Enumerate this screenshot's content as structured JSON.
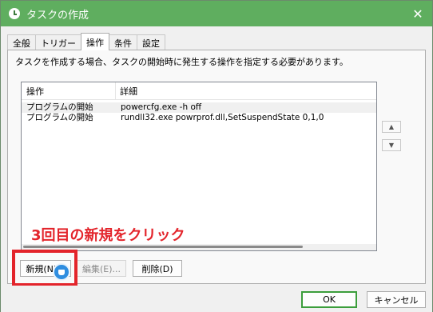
{
  "window": {
    "title": "タスクの作成",
    "close_symbol": "✕"
  },
  "tabs": [
    {
      "label": "全般",
      "active": false
    },
    {
      "label": "トリガー",
      "active": false
    },
    {
      "label": "操作",
      "active": true
    },
    {
      "label": "条件",
      "active": false
    },
    {
      "label": "設定",
      "active": false
    }
  ],
  "instruction": "タスクを作成する場合、タスクの開始時に発生する操作を指定する必要があります。",
  "list": {
    "columns": [
      "操作",
      "詳細"
    ],
    "rows": [
      {
        "action": "プログラムの開始",
        "detail": "powercfg.exe -h off"
      },
      {
        "action": "プログラムの開始",
        "detail": "rundll32.exe powrprof.dll,SetSuspendState 0,1,0"
      }
    ]
  },
  "move_buttons": {
    "up_symbol": "▲",
    "down_symbol": "▼"
  },
  "buttons": {
    "new": "新規(N)...",
    "edit": "編集(E)...",
    "delete": "削除(D)",
    "ok": "OK",
    "cancel": "キャンセル"
  },
  "annotation": {
    "text": "3回目の新規をクリック",
    "color": "#e3242b"
  },
  "colors": {
    "titlebar": "#5fae5f",
    "accent_border": "#3c9e3c",
    "cursor": "#2f8ee0"
  },
  "icons": {
    "title": "clock-icon",
    "close": "close-icon",
    "up": "arrow-up-icon",
    "down": "arrow-down-icon",
    "cursor": "hand-cursor-icon"
  }
}
